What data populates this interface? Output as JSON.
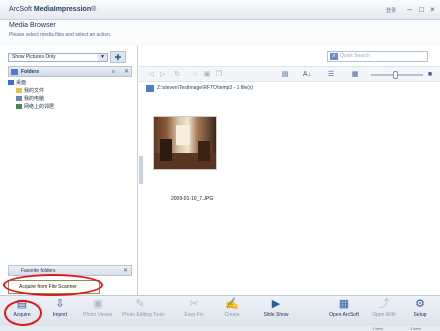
{
  "window": {
    "title_prefix": "ArcSoft ",
    "title_bold": "MediaImpression",
    "title_suffix": "®",
    "sign_in": "登录",
    "minimize": "–",
    "maximize": "□",
    "close": "×"
  },
  "header": {
    "title": "Media Browser",
    "subtitle": "Please select media files and select an action."
  },
  "left_panel": {
    "show_select": "Show Pictures Only",
    "folders_label": "Folders",
    "folders_icons": "≡  ✕",
    "tree": [
      {
        "label": "桌面",
        "level": 0,
        "icon": "desktop-icon",
        "color": "#3c6fc4"
      },
      {
        "label": "我的文件",
        "level": 1,
        "icon": "folder-icon",
        "color": "#e7c14a"
      },
      {
        "label": "我的电脑",
        "level": 1,
        "icon": "computer-icon",
        "color": "#6a86ad"
      },
      {
        "label": "网络上的邻居",
        "level": 1,
        "icon": "network-icon",
        "color": "#3f8c4c"
      }
    ],
    "favorites_label": "Favorite folders",
    "favorites_close": "✕"
  },
  "tooltip": {
    "text": "Acquire from File Scanner"
  },
  "right_panel": {
    "search_placeholder": "Quick Search",
    "path": "Z:\\steven\\TestImage\\RFTO\\temp3 - 1 file(s)",
    "photo_name": "2009-01-10_7.JPG"
  },
  "bottom_toolbar": [
    {
      "label": "Acquire",
      "icon": "scanner-icon",
      "glyph": "▤",
      "enabled": true
    },
    {
      "label": "Import",
      "icon": "import-icon",
      "glyph": "⇩",
      "enabled": true
    },
    {
      "label": "Photo Viewer",
      "icon": "photo-viewer-icon",
      "glyph": "▣",
      "enabled": false
    },
    {
      "label": "Photo Editing Tools",
      "icon": "photo-editing-icon",
      "glyph": "✎",
      "enabled": false
    },
    {
      "label": "Easy Fix",
      "icon": "easy-fix-icon",
      "glyph": "✂",
      "enabled": false
    },
    {
      "label": "Create",
      "icon": "create-icon",
      "glyph": "✍",
      "enabled": false
    },
    {
      "label": "Slide Show",
      "icon": "slide-show-icon",
      "glyph": "▶",
      "enabled": true
    },
    {
      "label": "Open ArcSoft",
      "icon": "open-arcsoft-icon",
      "glyph": "▦",
      "enabled": true
    },
    {
      "label": "Open With",
      "icon": "open-with-icon",
      "glyph": "⤴",
      "enabled": false
    },
    {
      "label": "Setup",
      "icon": "setup-icon",
      "glyph": "⚙",
      "enabled": true
    }
  ],
  "status_bar": {
    "left": "",
    "mid": "1 item",
    "right": "1 item"
  },
  "colors": {
    "accent": "#2b5aa0",
    "highlight_ring": "#e01818"
  }
}
